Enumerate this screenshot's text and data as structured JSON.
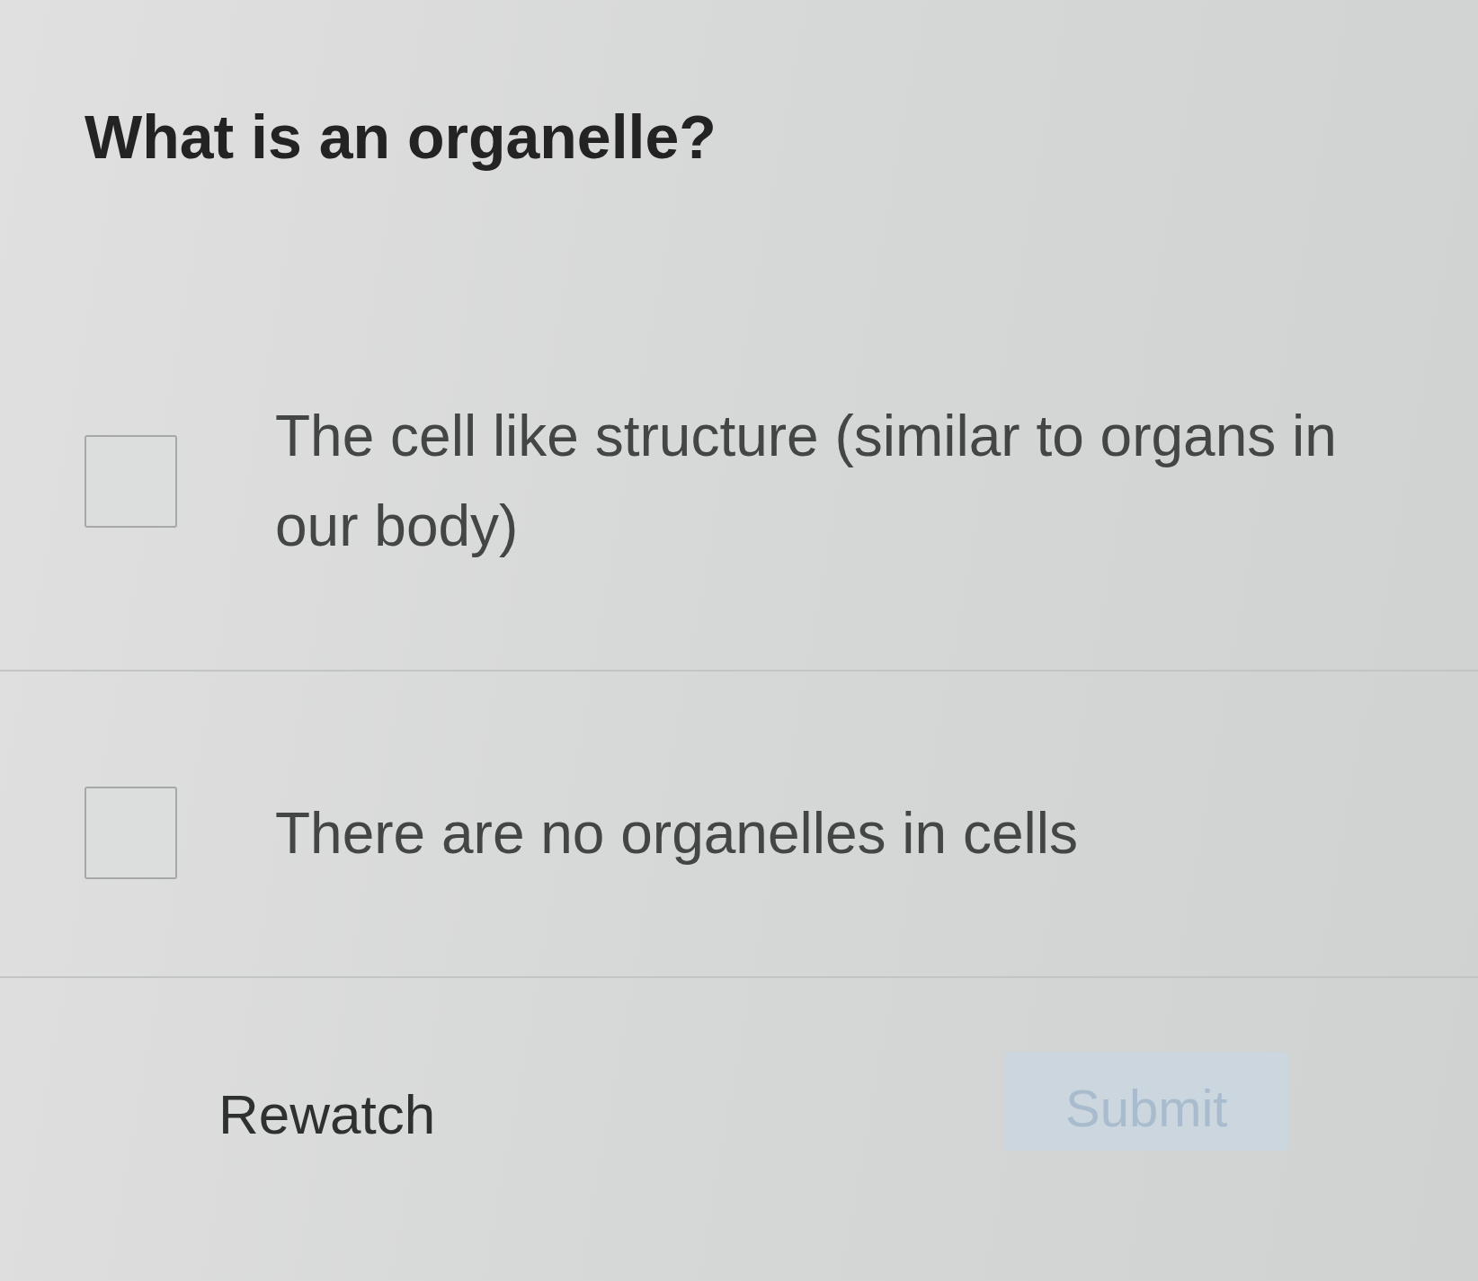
{
  "question": {
    "text": "What is an organelle?"
  },
  "options": [
    {
      "label": "The cell like structure (similar to organs in our body)",
      "checked": false
    },
    {
      "label": "There are no organelles in cells",
      "checked": false
    }
  ],
  "actions": [
    {
      "kind": "link",
      "label": "Rewatch",
      "disabled": false
    },
    {
      "kind": "button",
      "label": "Submit",
      "disabled": true
    }
  ]
}
